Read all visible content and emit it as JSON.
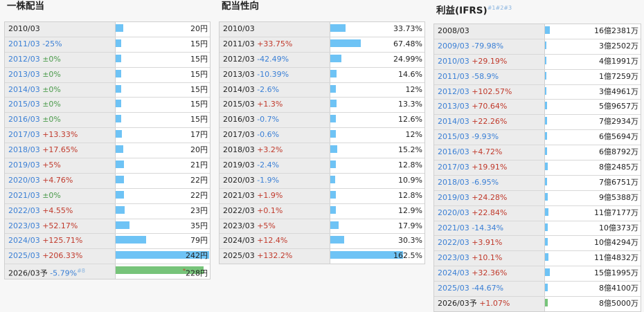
{
  "colors": {
    "bar": "#6ec3f5",
    "forecast_bar": "#77c47a",
    "up": "#c0392b",
    "down": "#3a7fd5",
    "flat": "#4a9a4a"
  },
  "dividend": {
    "title": "一株配当",
    "max": 242,
    "rows": [
      {
        "year": "2010/03",
        "change": "",
        "dir": "",
        "value": 20,
        "label": "20円"
      },
      {
        "year": "2011/03",
        "change": "-25%",
        "dir": "down",
        "value": 15,
        "label": "15円"
      },
      {
        "year": "2012/03",
        "change": "±0%",
        "dir": "flat",
        "value": 15,
        "label": "15円"
      },
      {
        "year": "2013/03",
        "change": "±0%",
        "dir": "flat",
        "value": 15,
        "label": "15円"
      },
      {
        "year": "2014/03",
        "change": "±0%",
        "dir": "flat",
        "value": 15,
        "label": "15円"
      },
      {
        "year": "2015/03",
        "change": "±0%",
        "dir": "flat",
        "value": 15,
        "label": "15円"
      },
      {
        "year": "2016/03",
        "change": "±0%",
        "dir": "flat",
        "value": 15,
        "label": "15円"
      },
      {
        "year": "2017/03",
        "change": "+13.33%",
        "dir": "up",
        "value": 17,
        "label": "17円"
      },
      {
        "year": "2018/03",
        "change": "+17.65%",
        "dir": "up",
        "value": 20,
        "label": "20円"
      },
      {
        "year": "2019/03",
        "change": "+5%",
        "dir": "up",
        "value": 21,
        "label": "21円"
      },
      {
        "year": "2020/03",
        "change": "+4.76%",
        "dir": "up",
        "value": 22,
        "label": "22円"
      },
      {
        "year": "2021/03",
        "change": "±0%",
        "dir": "flat",
        "value": 22,
        "label": "22円"
      },
      {
        "year": "2022/03",
        "change": "+4.55%",
        "dir": "up",
        "value": 23,
        "label": "23円"
      },
      {
        "year": "2023/03",
        "change": "+52.17%",
        "dir": "up",
        "value": 35,
        "label": "35円"
      },
      {
        "year": "2024/03",
        "change": "+125.71%",
        "dir": "up",
        "value": 79,
        "label": "79円"
      },
      {
        "year": "2025/03",
        "change": "+206.33%",
        "dir": "up",
        "value": 242,
        "label": "242円"
      },
      {
        "year": "2026/03予",
        "change": "-5.79%",
        "dir": "down",
        "note": "#8",
        "forecast": true,
        "value": 228,
        "label": "228円",
        "est": "*"
      }
    ]
  },
  "payout": {
    "title": "配当性向",
    "max": 162.5,
    "rows": [
      {
        "year": "2010/03",
        "change": "",
        "dir": "",
        "value": 33.73,
        "label": "33.73%"
      },
      {
        "year": "2011/03",
        "change": "+33.75%",
        "dir": "up",
        "value": 67.48,
        "label": "67.48%"
      },
      {
        "year": "2012/03",
        "change": "-42.49%",
        "dir": "down",
        "value": 24.99,
        "label": "24.99%"
      },
      {
        "year": "2013/03",
        "change": "-10.39%",
        "dir": "down",
        "value": 14.6,
        "label": "14.6%"
      },
      {
        "year": "2014/03",
        "change": "-2.6%",
        "dir": "down",
        "value": 12,
        "label": "12%"
      },
      {
        "year": "2015/03",
        "change": "+1.3%",
        "dir": "up",
        "value": 13.3,
        "label": "13.3%"
      },
      {
        "year": "2016/03",
        "change": "-0.7%",
        "dir": "down",
        "value": 12.6,
        "label": "12.6%"
      },
      {
        "year": "2017/03",
        "change": "-0.6%",
        "dir": "down",
        "value": 12,
        "label": "12%"
      },
      {
        "year": "2018/03",
        "change": "+3.2%",
        "dir": "up",
        "value": 15.2,
        "label": "15.2%"
      },
      {
        "year": "2019/03",
        "change": "-2.4%",
        "dir": "down",
        "value": 12.8,
        "label": "12.8%"
      },
      {
        "year": "2020/03",
        "change": "-1.9%",
        "dir": "down",
        "value": 10.9,
        "label": "10.9%"
      },
      {
        "year": "2021/03",
        "change": "+1.9%",
        "dir": "up",
        "value": 12.8,
        "label": "12.8%"
      },
      {
        "year": "2022/03",
        "change": "+0.1%",
        "dir": "up",
        "value": 12.9,
        "label": "12.9%"
      },
      {
        "year": "2023/03",
        "change": "+5%",
        "dir": "up",
        "value": 17.9,
        "label": "17.9%"
      },
      {
        "year": "2024/03",
        "change": "+12.4%",
        "dir": "up",
        "value": 30.3,
        "label": "30.3%"
      },
      {
        "year": "2025/03",
        "change": "+132.2%",
        "dir": "up",
        "value": 162.5,
        "label": "162.5%"
      }
    ]
  },
  "profit": {
    "title": "利益(IFRS)",
    "title_notes": "#1#2#3",
    "max": 162381,
    "rows": [
      {
        "year": "2008/03",
        "change": "",
        "dir": "",
        "value": 162381,
        "label": "16億2381万"
      },
      {
        "year": "2009/03",
        "change": "-79.98%",
        "dir": "down",
        "value": 32502,
        "label": "3億2502万"
      },
      {
        "year": "2010/03",
        "change": "+29.19%",
        "dir": "up",
        "value": 41991,
        "label": "4億1991万"
      },
      {
        "year": "2011/03",
        "change": "-58.9%",
        "dir": "down",
        "value": 17259,
        "label": "1億7259万"
      },
      {
        "year": "2012/03",
        "change": "+102.57%",
        "dir": "up",
        "value": 34961,
        "label": "3億4961万"
      },
      {
        "year": "2013/03",
        "change": "+70.64%",
        "dir": "up",
        "value": 59657,
        "label": "5億9657万"
      },
      {
        "year": "2014/03",
        "change": "+22.26%",
        "dir": "up",
        "value": 72934,
        "label": "7億2934万"
      },
      {
        "year": "2015/03",
        "change": "-9.93%",
        "dir": "down",
        "value": 65694,
        "label": "6億5694万"
      },
      {
        "year": "2016/03",
        "change": "+4.72%",
        "dir": "up",
        "value": 68792,
        "label": "6億8792万"
      },
      {
        "year": "2017/03",
        "change": "+19.91%",
        "dir": "up",
        "value": 82485,
        "label": "8億2485万"
      },
      {
        "year": "2018/03",
        "change": "-6.95%",
        "dir": "down",
        "value": 76751,
        "label": "7億6751万"
      },
      {
        "year": "2019/03",
        "change": "+24.28%",
        "dir": "up",
        "value": 95388,
        "label": "9億5388万"
      },
      {
        "year": "2020/03",
        "change": "+22.84%",
        "dir": "up",
        "value": 117177,
        "label": "11億7177万"
      },
      {
        "year": "2021/03",
        "change": "-14.34%",
        "dir": "down",
        "value": 100373,
        "label": "10億373万"
      },
      {
        "year": "2022/03",
        "change": "+3.91%",
        "dir": "up",
        "value": 104294,
        "label": "10億4294万"
      },
      {
        "year": "2023/03",
        "change": "+10.1%",
        "dir": "up",
        "value": 114832,
        "label": "11億4832万"
      },
      {
        "year": "2024/03",
        "change": "+32.36%",
        "dir": "up",
        "value": 151995,
        "label": "15億1995万"
      },
      {
        "year": "2025/03",
        "change": "-44.67%",
        "dir": "down",
        "value": 84100,
        "label": "8億4100万"
      },
      {
        "year": "2026/03予",
        "change": "+1.07%",
        "dir": "up",
        "forecast": true,
        "value": 85000,
        "label": "8億5000万"
      }
    ]
  }
}
